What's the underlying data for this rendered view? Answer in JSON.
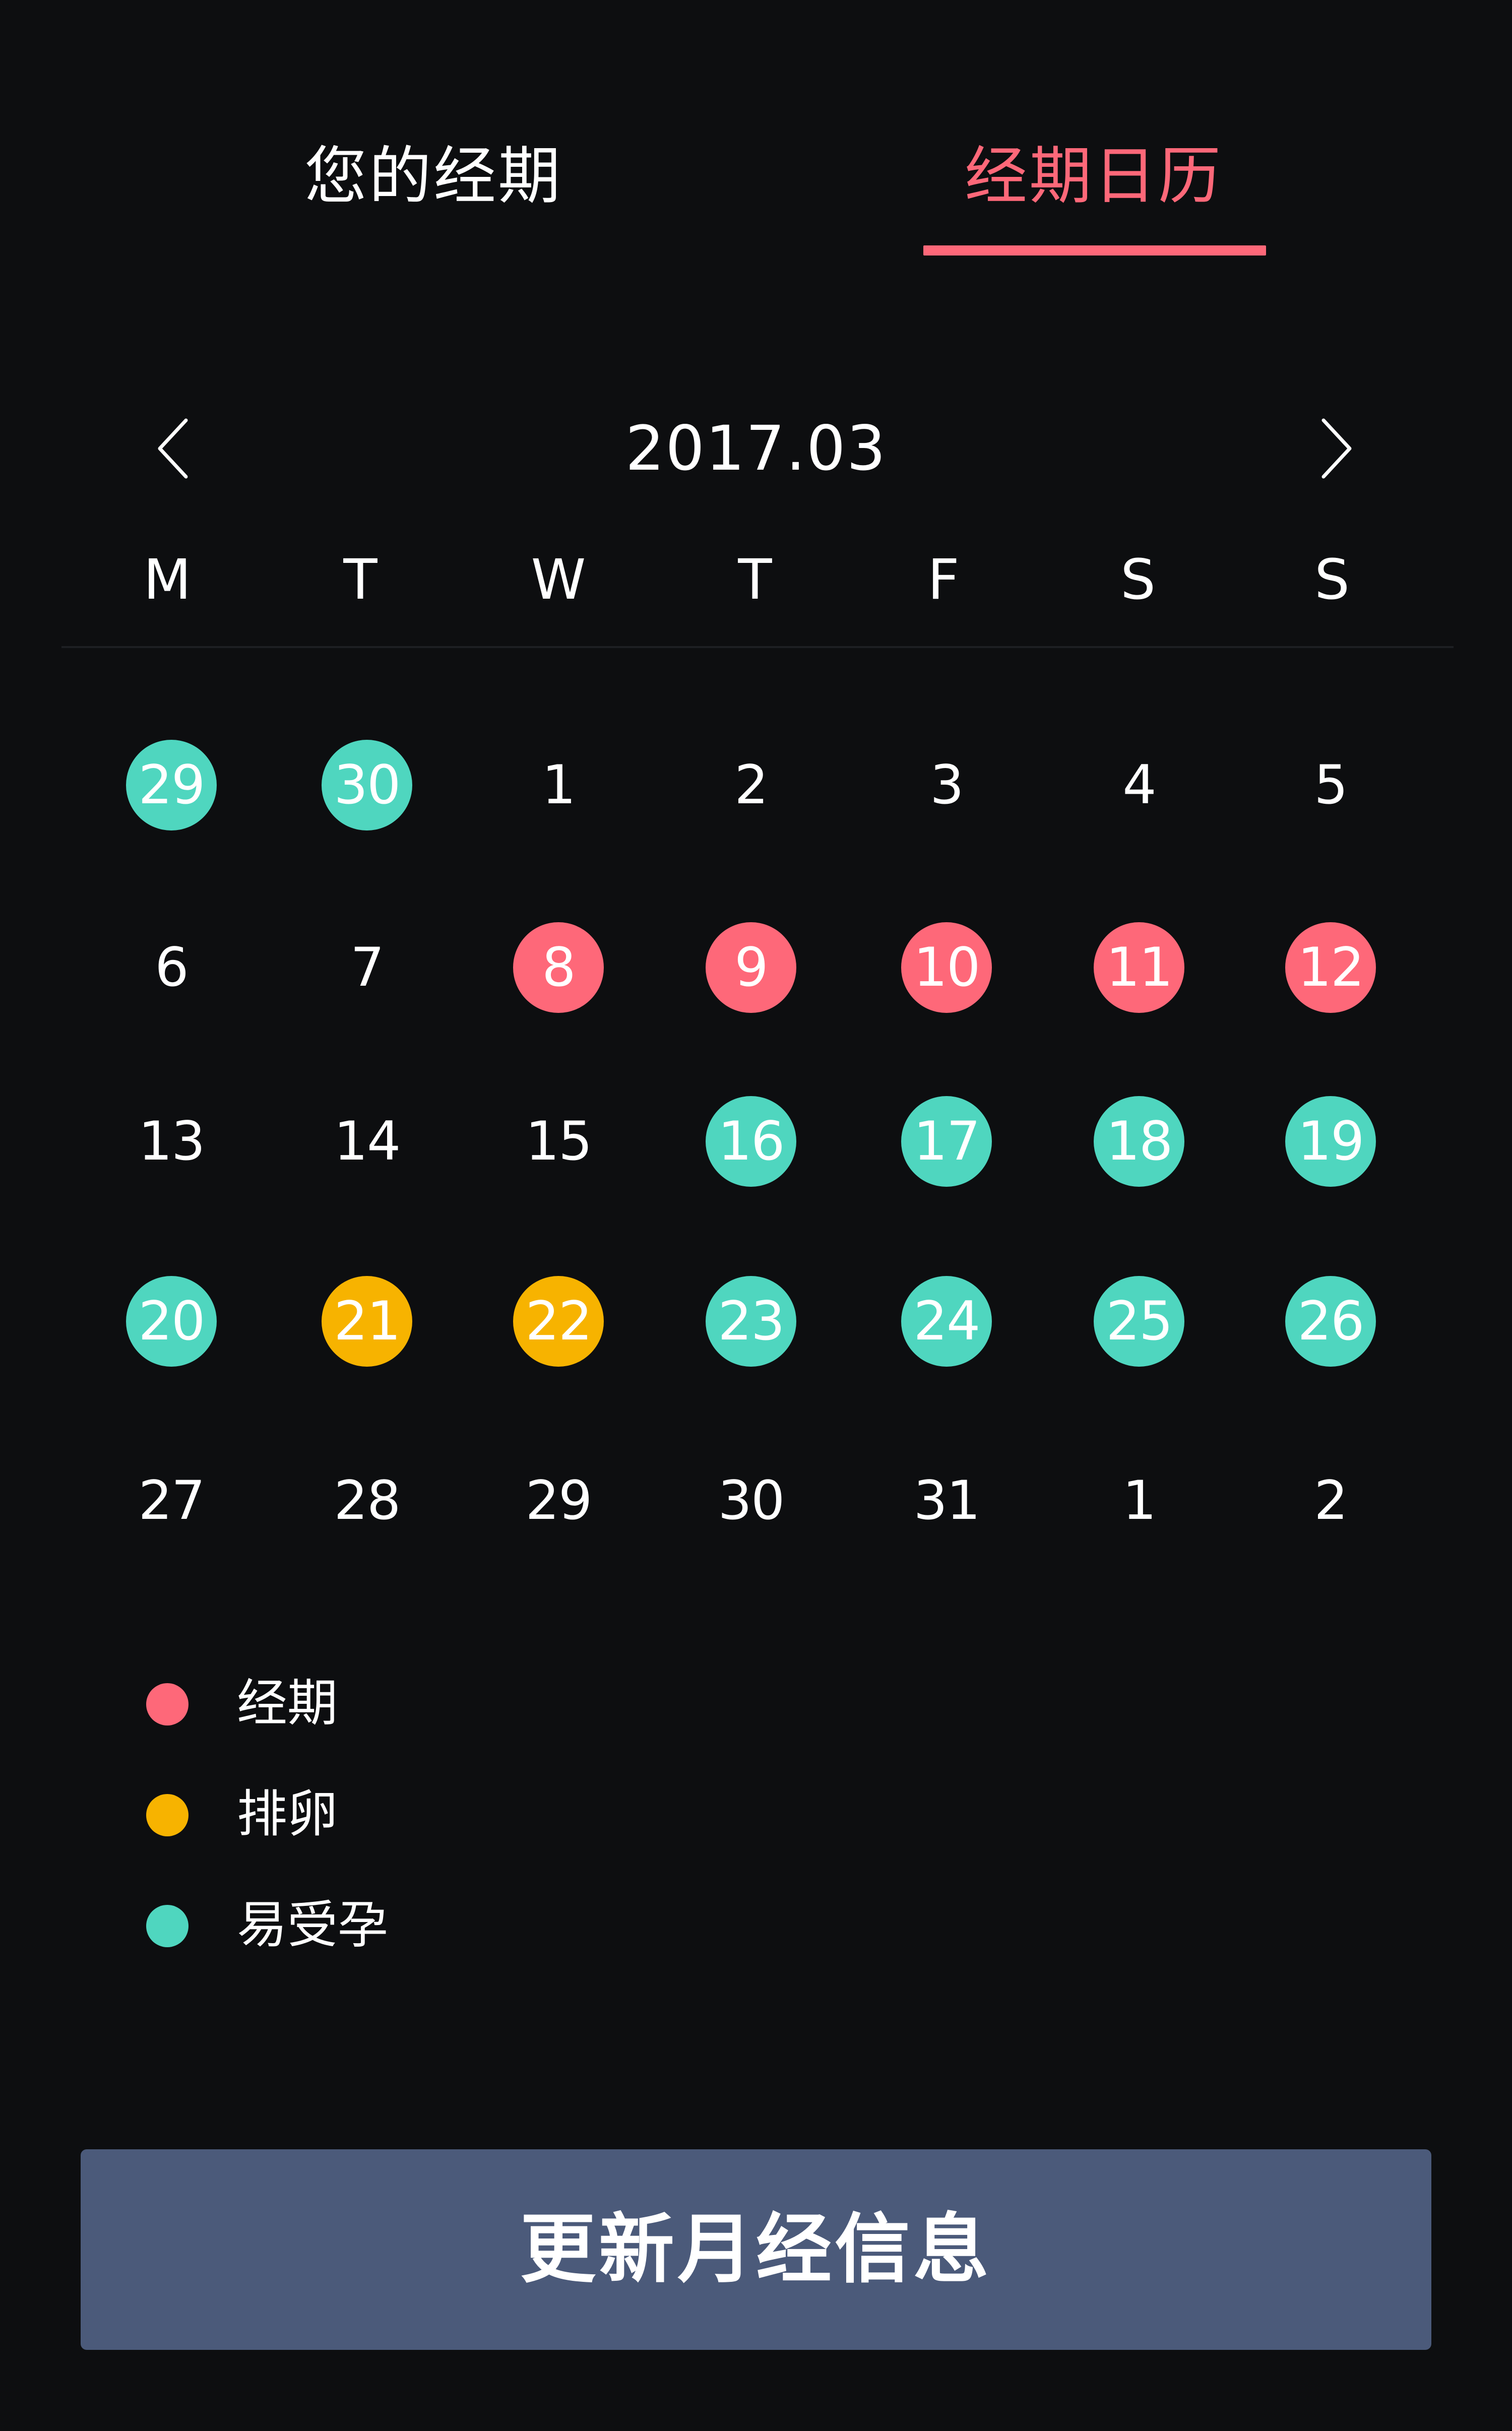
{
  "tabs": [
    {
      "label": "您的经期",
      "active": false
    },
    {
      "label": "经期日历",
      "active": true
    }
  ],
  "colors": {
    "accent": "#fe6879",
    "period": "#fe6879",
    "ovulation": "#f7b300",
    "fertile": "#4fd6bf",
    "button": "#4b5a7a",
    "background": "#0d0e10"
  },
  "calendar": {
    "month": "2017.03",
    "prev_icon": "chevron-left-icon",
    "next_icon": "chevron-right-icon",
    "weekdays": [
      "M",
      "T",
      "W",
      "T",
      "F",
      "S",
      "S"
    ],
    "weeks": [
      [
        {
          "day": "29",
          "type": "fertile"
        },
        {
          "day": "30",
          "type": "fertile"
        },
        {
          "day": "1",
          "type": "none"
        },
        {
          "day": "2",
          "type": "none"
        },
        {
          "day": "3",
          "type": "none"
        },
        {
          "day": "4",
          "type": "none"
        },
        {
          "day": "5",
          "type": "none"
        }
      ],
      [
        {
          "day": "6",
          "type": "none"
        },
        {
          "day": "7",
          "type": "none"
        },
        {
          "day": "8",
          "type": "period"
        },
        {
          "day": "9",
          "type": "period"
        },
        {
          "day": "10",
          "type": "period"
        },
        {
          "day": "11",
          "type": "period"
        },
        {
          "day": "12",
          "type": "period"
        }
      ],
      [
        {
          "day": "13",
          "type": "none"
        },
        {
          "day": "14",
          "type": "none"
        },
        {
          "day": "15",
          "type": "none"
        },
        {
          "day": "16",
          "type": "fertile"
        },
        {
          "day": "17",
          "type": "fertile"
        },
        {
          "day": "18",
          "type": "fertile"
        },
        {
          "day": "19",
          "type": "fertile"
        }
      ],
      [
        {
          "day": "20",
          "type": "fertile"
        },
        {
          "day": "21",
          "type": "ovulation"
        },
        {
          "day": "22",
          "type": "ovulation"
        },
        {
          "day": "23",
          "type": "fertile"
        },
        {
          "day": "24",
          "type": "fertile"
        },
        {
          "day": "25",
          "type": "fertile"
        },
        {
          "day": "26",
          "type": "fertile"
        }
      ],
      [
        {
          "day": "27",
          "type": "none"
        },
        {
          "day": "28",
          "type": "none"
        },
        {
          "day": "29",
          "type": "none"
        },
        {
          "day": "30",
          "type": "none"
        },
        {
          "day": "31",
          "type": "none"
        },
        {
          "day": "1",
          "type": "none"
        },
        {
          "day": "2",
          "type": "none"
        }
      ]
    ]
  },
  "legend": [
    {
      "label": "经期",
      "type": "period"
    },
    {
      "label": "排卵",
      "type": "ovulation"
    },
    {
      "label": "易受孕",
      "type": "fertile"
    }
  ],
  "update_button": {
    "label": "更新月经信息"
  }
}
